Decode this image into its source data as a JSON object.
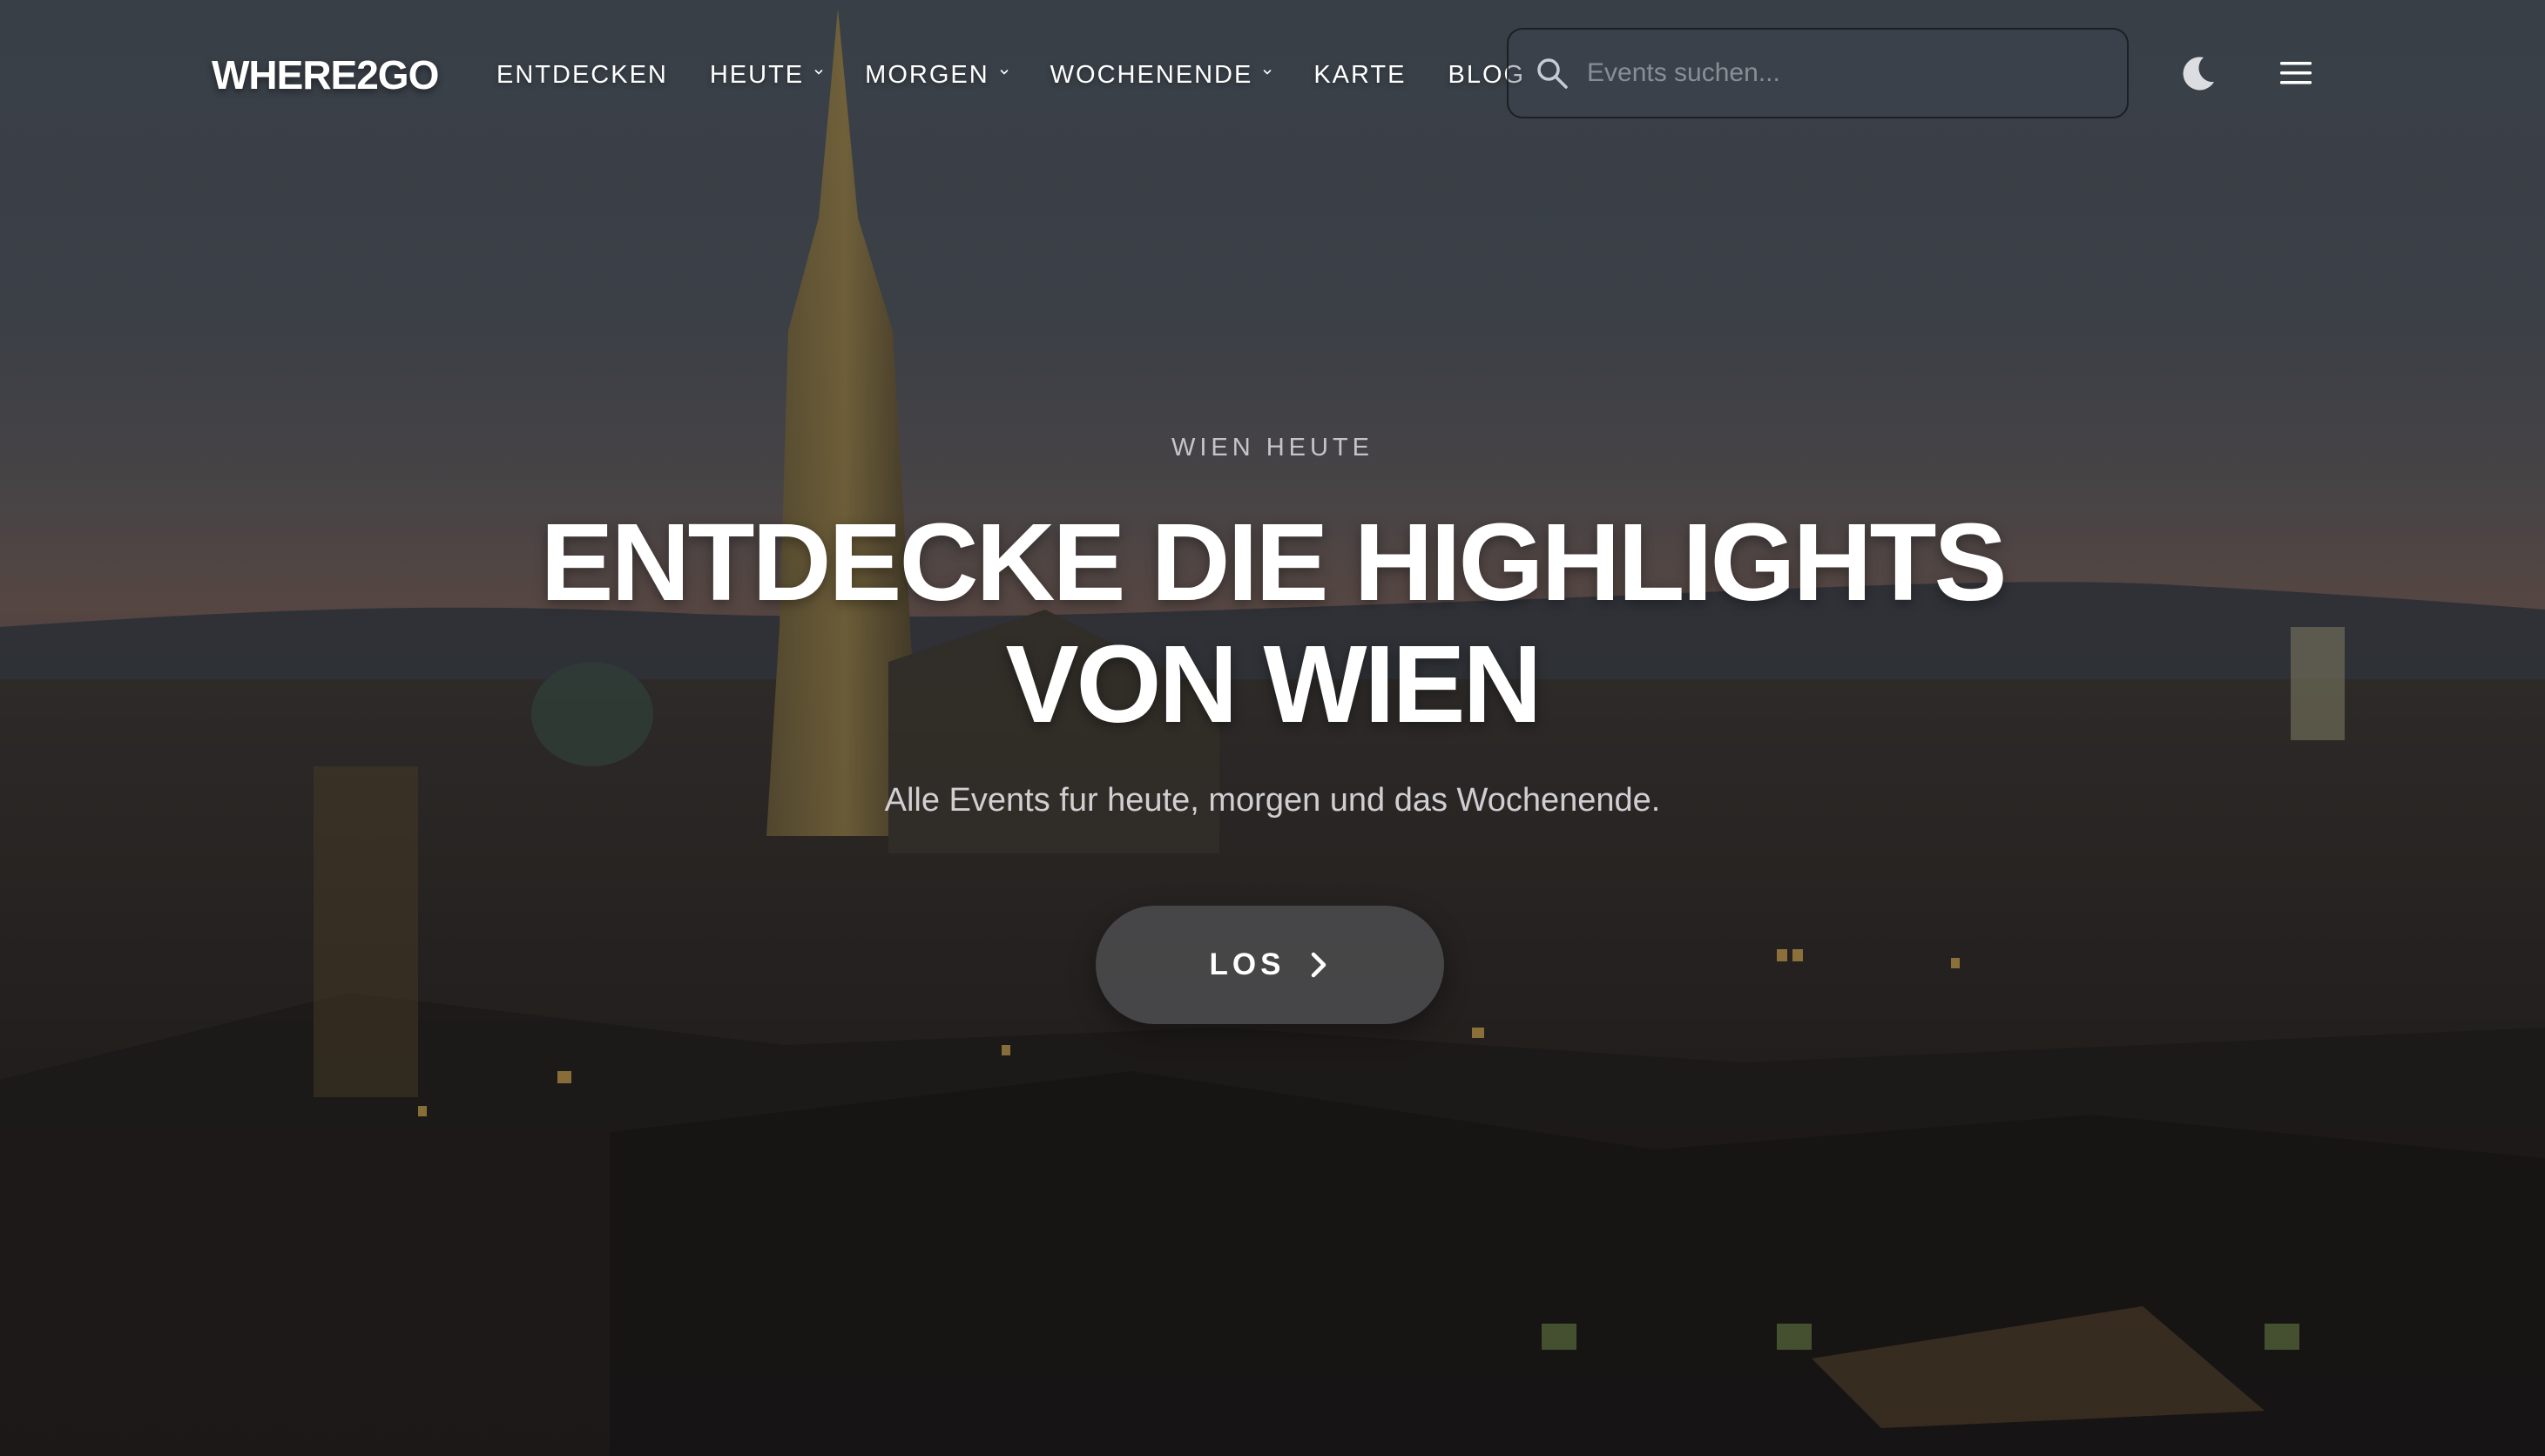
{
  "brand": {
    "logo": "WHERE2GO"
  },
  "nav": {
    "items": [
      {
        "label": "ENTDECKEN",
        "has_dropdown": false
      },
      {
        "label": "HEUTE",
        "has_dropdown": true
      },
      {
        "label": "MORGEN",
        "has_dropdown": true
      },
      {
        "label": "WOCHENENDE",
        "has_dropdown": true
      },
      {
        "label": "KARTE",
        "has_dropdown": false
      },
      {
        "label": "BLOG",
        "has_dropdown": false
      }
    ],
    "search": {
      "placeholder": "Events suchen...",
      "value": "",
      "icon": "search-icon"
    },
    "theme_toggle_icon": "moon-icon",
    "menu_icon": "hamburger-menu-icon"
  },
  "hero": {
    "eyebrow": "WIEN HEUTE",
    "headline_line1": "ENTDECKE DIE HIGHLIGHTS",
    "headline_line2": "VON WIEN",
    "subline": "Alle Events fur heute, morgen und das Wochenende.",
    "cta_label": "LOS",
    "cta_icon": "chevron-right-icon",
    "background": "vienna-skyline-dusk-photo"
  },
  "colors": {
    "text": "#ffffff",
    "cta_bg": "#4e4e50",
    "overlay": "#1c1b1c"
  }
}
